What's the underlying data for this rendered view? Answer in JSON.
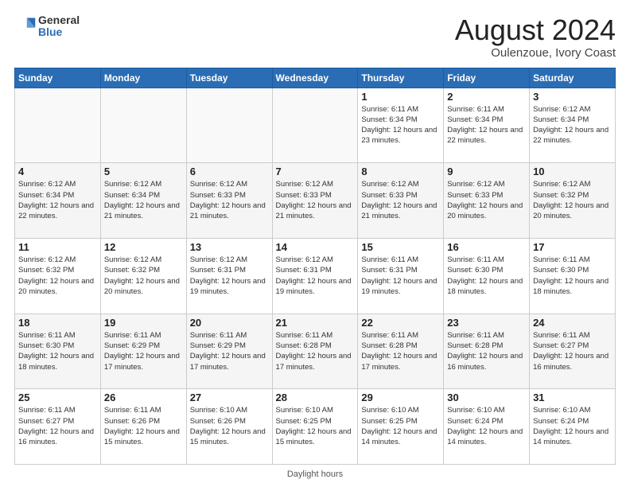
{
  "header": {
    "logo_general": "General",
    "logo_blue": "Blue",
    "title": "August 2024",
    "subtitle": "Oulenzoue, Ivory Coast"
  },
  "weekdays": [
    "Sunday",
    "Monday",
    "Tuesday",
    "Wednesday",
    "Thursday",
    "Friday",
    "Saturday"
  ],
  "footer_text": "Daylight hours",
  "weeks": [
    [
      {
        "day": "",
        "content": ""
      },
      {
        "day": "",
        "content": ""
      },
      {
        "day": "",
        "content": ""
      },
      {
        "day": "",
        "content": ""
      },
      {
        "day": "1",
        "content": "Sunrise: 6:11 AM\nSunset: 6:34 PM\nDaylight: 12 hours and 23 minutes."
      },
      {
        "day": "2",
        "content": "Sunrise: 6:11 AM\nSunset: 6:34 PM\nDaylight: 12 hours and 22 minutes."
      },
      {
        "day": "3",
        "content": "Sunrise: 6:12 AM\nSunset: 6:34 PM\nDaylight: 12 hours and 22 minutes."
      }
    ],
    [
      {
        "day": "4",
        "content": "Sunrise: 6:12 AM\nSunset: 6:34 PM\nDaylight: 12 hours and 22 minutes."
      },
      {
        "day": "5",
        "content": "Sunrise: 6:12 AM\nSunset: 6:34 PM\nDaylight: 12 hours and 21 minutes."
      },
      {
        "day": "6",
        "content": "Sunrise: 6:12 AM\nSunset: 6:33 PM\nDaylight: 12 hours and 21 minutes."
      },
      {
        "day": "7",
        "content": "Sunrise: 6:12 AM\nSunset: 6:33 PM\nDaylight: 12 hours and 21 minutes."
      },
      {
        "day": "8",
        "content": "Sunrise: 6:12 AM\nSunset: 6:33 PM\nDaylight: 12 hours and 21 minutes."
      },
      {
        "day": "9",
        "content": "Sunrise: 6:12 AM\nSunset: 6:33 PM\nDaylight: 12 hours and 20 minutes."
      },
      {
        "day": "10",
        "content": "Sunrise: 6:12 AM\nSunset: 6:32 PM\nDaylight: 12 hours and 20 minutes."
      }
    ],
    [
      {
        "day": "11",
        "content": "Sunrise: 6:12 AM\nSunset: 6:32 PM\nDaylight: 12 hours and 20 minutes."
      },
      {
        "day": "12",
        "content": "Sunrise: 6:12 AM\nSunset: 6:32 PM\nDaylight: 12 hours and 20 minutes."
      },
      {
        "day": "13",
        "content": "Sunrise: 6:12 AM\nSunset: 6:31 PM\nDaylight: 12 hours and 19 minutes."
      },
      {
        "day": "14",
        "content": "Sunrise: 6:12 AM\nSunset: 6:31 PM\nDaylight: 12 hours and 19 minutes."
      },
      {
        "day": "15",
        "content": "Sunrise: 6:11 AM\nSunset: 6:31 PM\nDaylight: 12 hours and 19 minutes."
      },
      {
        "day": "16",
        "content": "Sunrise: 6:11 AM\nSunset: 6:30 PM\nDaylight: 12 hours and 18 minutes."
      },
      {
        "day": "17",
        "content": "Sunrise: 6:11 AM\nSunset: 6:30 PM\nDaylight: 12 hours and 18 minutes."
      }
    ],
    [
      {
        "day": "18",
        "content": "Sunrise: 6:11 AM\nSunset: 6:30 PM\nDaylight: 12 hours and 18 minutes."
      },
      {
        "day": "19",
        "content": "Sunrise: 6:11 AM\nSunset: 6:29 PM\nDaylight: 12 hours and 17 minutes."
      },
      {
        "day": "20",
        "content": "Sunrise: 6:11 AM\nSunset: 6:29 PM\nDaylight: 12 hours and 17 minutes."
      },
      {
        "day": "21",
        "content": "Sunrise: 6:11 AM\nSunset: 6:28 PM\nDaylight: 12 hours and 17 minutes."
      },
      {
        "day": "22",
        "content": "Sunrise: 6:11 AM\nSunset: 6:28 PM\nDaylight: 12 hours and 17 minutes."
      },
      {
        "day": "23",
        "content": "Sunrise: 6:11 AM\nSunset: 6:28 PM\nDaylight: 12 hours and 16 minutes."
      },
      {
        "day": "24",
        "content": "Sunrise: 6:11 AM\nSunset: 6:27 PM\nDaylight: 12 hours and 16 minutes."
      }
    ],
    [
      {
        "day": "25",
        "content": "Sunrise: 6:11 AM\nSunset: 6:27 PM\nDaylight: 12 hours and 16 minutes."
      },
      {
        "day": "26",
        "content": "Sunrise: 6:11 AM\nSunset: 6:26 PM\nDaylight: 12 hours and 15 minutes."
      },
      {
        "day": "27",
        "content": "Sunrise: 6:10 AM\nSunset: 6:26 PM\nDaylight: 12 hours and 15 minutes."
      },
      {
        "day": "28",
        "content": "Sunrise: 6:10 AM\nSunset: 6:25 PM\nDaylight: 12 hours and 15 minutes."
      },
      {
        "day": "29",
        "content": "Sunrise: 6:10 AM\nSunset: 6:25 PM\nDaylight: 12 hours and 14 minutes."
      },
      {
        "day": "30",
        "content": "Sunrise: 6:10 AM\nSunset: 6:24 PM\nDaylight: 12 hours and 14 minutes."
      },
      {
        "day": "31",
        "content": "Sunrise: 6:10 AM\nSunset: 6:24 PM\nDaylight: 12 hours and 14 minutes."
      }
    ]
  ]
}
